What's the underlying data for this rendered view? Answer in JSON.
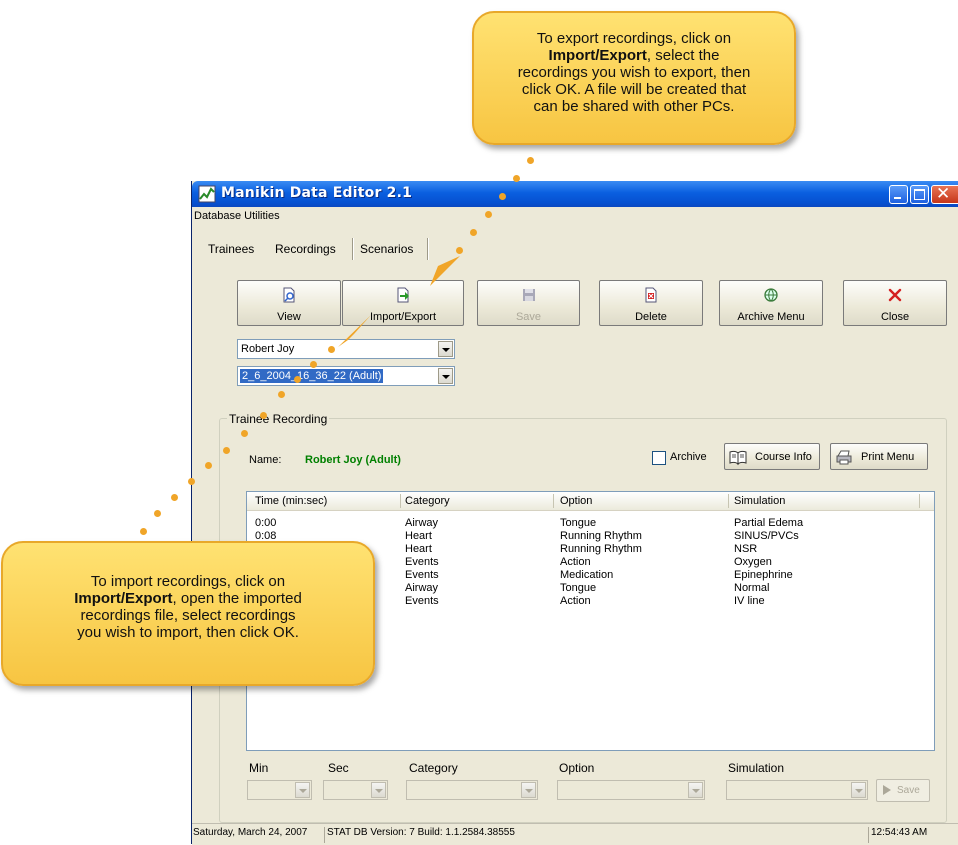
{
  "window": {
    "title": "Manikin Data Editor 2.1"
  },
  "menu": [
    "Database Utilities"
  ],
  "tabs": [
    {
      "label": "Trainees"
    },
    {
      "label": "Recordings",
      "active": true
    },
    {
      "label": "Scenarios"
    }
  ],
  "toolbar": {
    "view_label": "View",
    "import_export_label": "Import/Export",
    "save_label": "Save",
    "delete_label": "Delete",
    "archive_menu_label": "Archive Menu",
    "close_label": "Close"
  },
  "selectors": {
    "trainee_value": "Robert Joy",
    "recording_value": "2_6_2004_16_36_22 (Adult)"
  },
  "trainee_recording": {
    "group_title": "Trainee Recording",
    "name_label": "Name:",
    "name_value": "Robert Joy (Adult)",
    "archive_label": "Archive",
    "course_info_label": "Course Info",
    "print_menu_label": "Print Menu"
  },
  "list": {
    "columns": [
      "Time (min:sec)",
      "Category",
      "Option",
      "Simulation"
    ],
    "rows": [
      [
        "0:00",
        "Airway",
        "Tongue",
        "Partial Edema"
      ],
      [
        "0:08",
        "Heart",
        "Running Rhythm",
        "SINUS/PVCs"
      ],
      [
        "",
        "Heart",
        "Running Rhythm",
        "NSR"
      ],
      [
        "",
        "Events",
        "Action",
        "Oxygen"
      ],
      [
        "",
        "Events",
        "Medication",
        "Epinephrine"
      ],
      [
        "",
        "Airway",
        "Tongue",
        "Normal"
      ],
      [
        "",
        "Events",
        "Action",
        "IV line"
      ]
    ]
  },
  "filters": {
    "min_label": "Min",
    "sec_label": "Sec",
    "category_label": "Category",
    "option_label": "Option",
    "simulation_label": "Simulation",
    "save_label": "Save"
  },
  "statusbar": {
    "date": "Saturday, March 24, 2007",
    "version": "STAT DB Version: 7  Build: 1.1.2584.38555",
    "time": "12:54:43 AM"
  },
  "callouts": {
    "export": {
      "line1": "To export recordings, click on",
      "bold": "Import/Export",
      "line2": ", select the",
      "line3": "recordings you wish to export, then",
      "line4": "click OK.  A file will be created that",
      "line5": "can be shared with other PCs."
    },
    "import": {
      "line1": "To import recordings, click on",
      "bold": "Import/Export",
      "line2": ", open the imported",
      "line3": "recordings file, select recordings",
      "line4": "you wish to import, then click OK."
    }
  },
  "colors": {
    "titlebar": "#0a5fe0",
    "window_bg": "#ece9d8",
    "selection": "#316ac5",
    "name_green": "#008000",
    "callout_fill": "#f7c542",
    "callout_dots": "#f0a528"
  }
}
